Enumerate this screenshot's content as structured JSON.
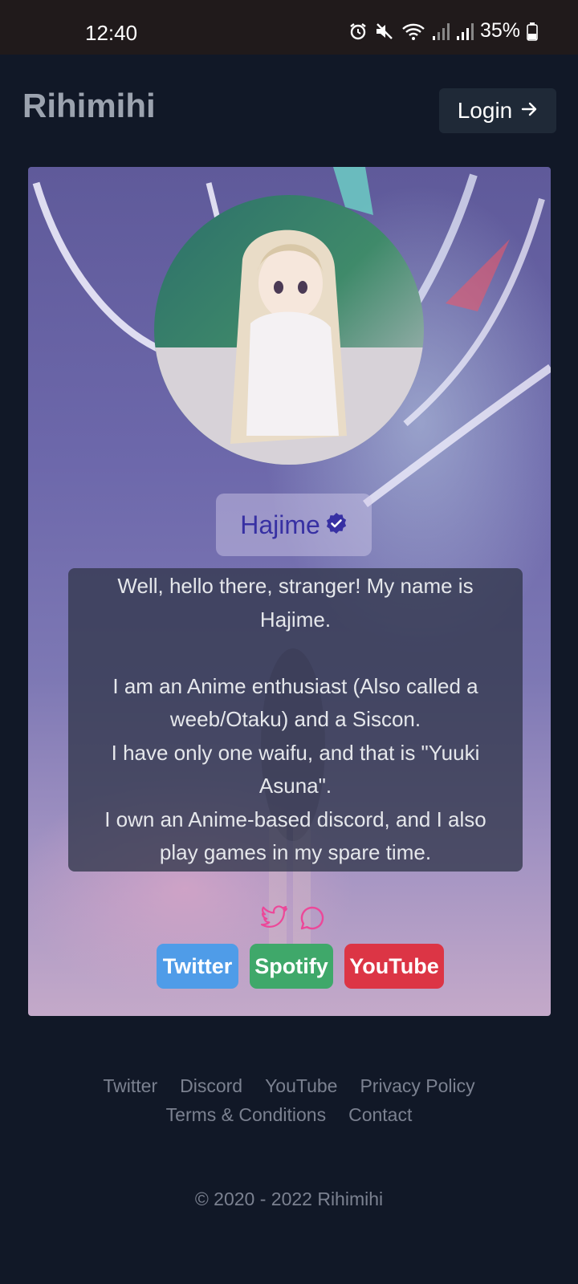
{
  "status_bar": {
    "time": "12:40",
    "battery": "35%",
    "icons": [
      "alarm-icon",
      "mute-icon",
      "wifi-icon",
      "signal-icon",
      "signal-icon",
      "battery-icon"
    ]
  },
  "header": {
    "brand": "Rihimihi",
    "login_label": "Login",
    "login_icon": "arrow-right-icon"
  },
  "profile": {
    "name": "Hajime",
    "verified_icon": "verified-badge-icon",
    "bio_lines": [
      "Well, hello there, stranger! My name is",
      "Hajime.",
      "",
      "I am an Anime enthusiast (Also called a",
      "weeb/Otaku) and a Siscon.",
      "I have only one waifu, and that is \"Yuuki",
      "Asuna\".",
      "I own an Anime-based discord, and I also",
      "play games in my spare time."
    ],
    "social_icons": [
      "twitter-icon",
      "discord-chat-icon"
    ],
    "buttons": [
      {
        "label": "Twitter",
        "color": "#4f9ce8"
      },
      {
        "label": "Spotify",
        "color": "#3fa86a"
      },
      {
        "label": "YouTube",
        "color": "#dc3545"
      }
    ]
  },
  "footer": {
    "links_row1": [
      "Twitter",
      "Discord",
      "YouTube",
      "Privacy Policy"
    ],
    "links_row2": [
      "Terms & Conditions",
      "Contact"
    ],
    "copyright": "© 2020 - 2022 Rihimihi"
  },
  "colors": {
    "background": "#111827",
    "accent_pink": "#ec4899",
    "name_color": "#3730a3"
  }
}
